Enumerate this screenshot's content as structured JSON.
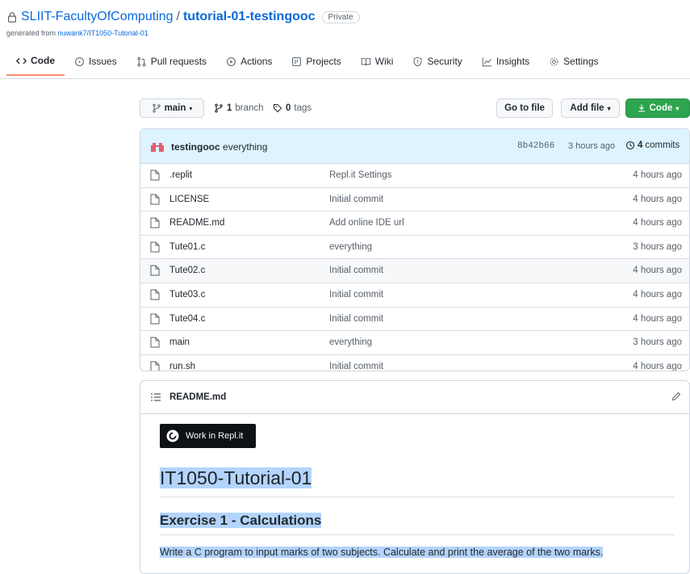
{
  "repo": {
    "owner": "SLIIT-FacultyOfComputing",
    "separator": "/",
    "name": "tutorial-01-testingooc",
    "visibility": "Private",
    "generated_prefix": "generated from",
    "generated_from": "nuwank7/IT1050-Tutorial-01"
  },
  "tabs": [
    {
      "label": "Code",
      "icon": "code-icon"
    },
    {
      "label": "Issues",
      "icon": "issues-icon"
    },
    {
      "label": "Pull requests",
      "icon": "pull-request-icon"
    },
    {
      "label": "Actions",
      "icon": "play-icon"
    },
    {
      "label": "Projects",
      "icon": "project-icon"
    },
    {
      "label": "Wiki",
      "icon": "book-icon"
    },
    {
      "label": "Security",
      "icon": "shield-icon"
    },
    {
      "label": "Insights",
      "icon": "graph-icon"
    },
    {
      "label": "Settings",
      "icon": "gear-icon"
    }
  ],
  "controls": {
    "branch": "main",
    "branch_count": "1",
    "branch_label": "branch",
    "tag_count": "0",
    "tag_label": "tags",
    "go_to_file": "Go to file",
    "add_file": "Add file",
    "code": "Code"
  },
  "latest_commit": {
    "author": "testingooc",
    "message": "everything",
    "sha": "8b42b66",
    "time": "3 hours ago",
    "commit_count": "4",
    "commit_label": "commits"
  },
  "files": [
    {
      "name": ".replit",
      "message": "Repl.it Settings",
      "time": "4 hours ago"
    },
    {
      "name": "LICENSE",
      "message": "Initial commit",
      "time": "4 hours ago"
    },
    {
      "name": "README.md",
      "message": "Add online IDE url",
      "time": "4 hours ago"
    },
    {
      "name": "Tute01.c",
      "message": "everything",
      "time": "3 hours ago"
    },
    {
      "name": "Tute02.c",
      "message": "Initial commit",
      "time": "4 hours ago"
    },
    {
      "name": "Tute03.c",
      "message": "Initial commit",
      "time": "4 hours ago"
    },
    {
      "name": "Tute04.c",
      "message": "Initial commit",
      "time": "4 hours ago"
    },
    {
      "name": "main",
      "message": "everything",
      "time": "3 hours ago"
    },
    {
      "name": "run.sh",
      "message": "Initial commit",
      "time": "4 hours ago"
    }
  ],
  "readme": {
    "filename": "README.md",
    "replit_button": "Work in Repl.it",
    "h1": "IT1050-Tutorial-01",
    "h2": "Exercise 1 - Calculations",
    "paragraph": "Write a C program to input marks of two subjects. Calculate and print the average of the two marks."
  },
  "colors": {
    "link": "#0969da",
    "green_button": "#2da44e",
    "active_tab_underline": "#fd8c73",
    "commit_bar": "#ddf4ff",
    "selection": "#b3d4fc"
  }
}
